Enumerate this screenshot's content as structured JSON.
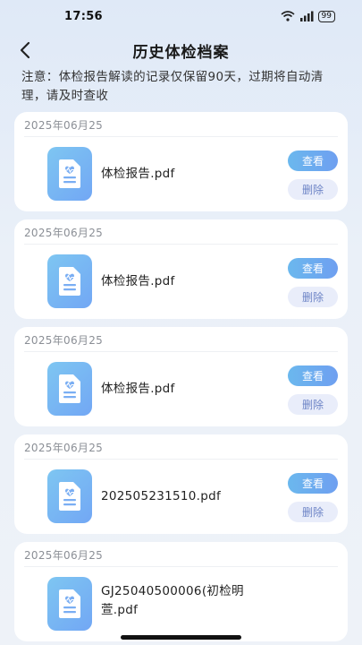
{
  "status_bar": {
    "time": "17:56",
    "battery": "99"
  },
  "header": {
    "title": "历史体检档案"
  },
  "notice": "注意：体检报告解读的记录仅保留90天，过期将自动清理，请及时查收",
  "records": [
    {
      "date": "2025年06月25",
      "file_name": "体检报告.pdf"
    },
    {
      "date": "2025年06月25",
      "file_name": "体检报告.pdf"
    },
    {
      "date": "2025年06月25",
      "file_name": "体检报告.pdf"
    },
    {
      "date": "2025年06月25",
      "file_name": "202505231510.pdf"
    },
    {
      "date": "2025年06月25",
      "file_name": "GJ25040500006(初检明萱.pdf"
    }
  ],
  "buttons": {
    "view": "查看",
    "delete": "删除"
  },
  "icons": {
    "back": "chevron-left-icon",
    "file": "medical-report-icon"
  },
  "colors": {
    "accent": "#6eaaf0",
    "delete_bg": "#e9edfa"
  }
}
